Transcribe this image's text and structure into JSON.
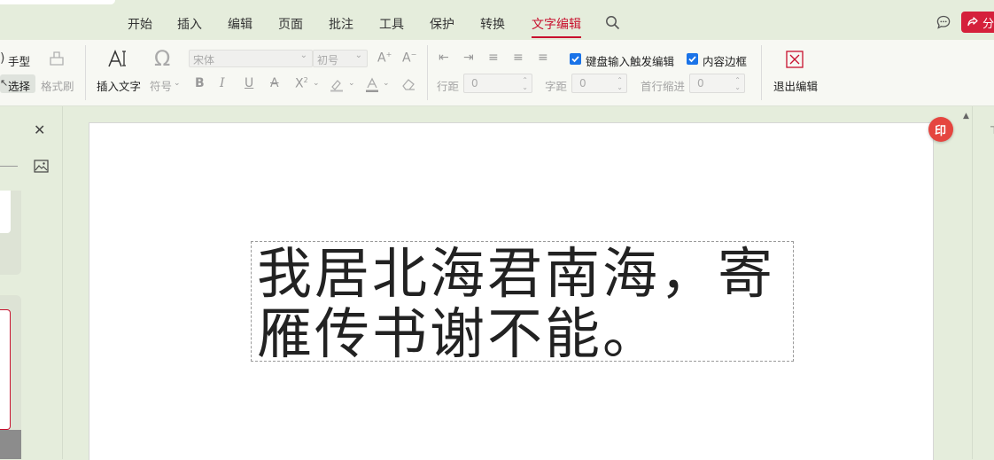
{
  "menubar": {
    "tabs": [
      {
        "label": "开始"
      },
      {
        "label": "插入"
      },
      {
        "label": "编辑"
      },
      {
        "label": "页面"
      },
      {
        "label": "批注"
      },
      {
        "label": "工具"
      },
      {
        "label": "保护"
      },
      {
        "label": "转换"
      },
      {
        "label": "文字编辑",
        "active": true
      }
    ],
    "share_label": "分",
    "accent": "#c8102e"
  },
  "ribbon": {
    "hand_label": "手型",
    "select_label": "选择",
    "format_brush_label": "格式刷",
    "insert_text_label": "插入文字",
    "symbol_label": "符号",
    "font_name": "宋体",
    "font_size": "初号",
    "line_spacing_label": "行距",
    "line_spacing_value": "0",
    "char_spacing_label": "字距",
    "char_spacing_value": "0",
    "indent_label": "首行缩进",
    "indent_value": "0",
    "keyboard_trigger_label": "键盘输入触发编辑",
    "keyboard_trigger_checked": true,
    "content_border_label": "内容边框",
    "content_border_checked": true,
    "exit_label": "退出编辑"
  },
  "document": {
    "text": "我居北海君南海，寄\n雁传书谢不能。"
  },
  "badge": {
    "label": "印"
  },
  "colors": {
    "background": "#e5eddc",
    "accent": "#c8102e",
    "checkbox": "#1a73e8"
  }
}
